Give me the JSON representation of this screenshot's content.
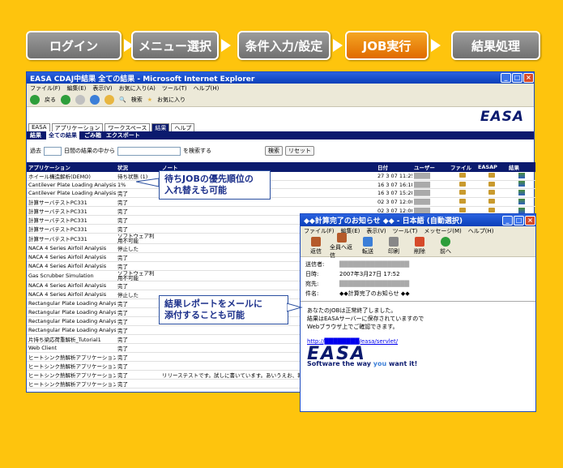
{
  "steps": [
    {
      "label": "ログイン",
      "active": false
    },
    {
      "label": "メニュー選択",
      "active": false
    },
    {
      "label": "条件入力/設定",
      "active": false
    },
    {
      "label": "JOB実行",
      "active": true
    },
    {
      "label": "結果処理",
      "active": false
    }
  ],
  "browser": {
    "title": "EASA CDAJ中結果 全ての結果 - Microsoft Internet Explorer",
    "menu": [
      "ファイル(F)",
      "編集(E)",
      "表示(V)",
      "お気に入り(A)",
      "ツール(T)",
      "ヘルプ(H)"
    ],
    "toolbar": {
      "back": "戻る",
      "search": "検索",
      "favorites": "お気に入り"
    },
    "logo": "EASA",
    "nav_tabs": [
      "EASA",
      "アプリケーション",
      "ワークスペース",
      "結果",
      "ヘルプ"
    ],
    "sub_tabs": [
      "結果",
      "全ての結果",
      "ごみ箱",
      "エクスポート"
    ],
    "filter": {
      "past_label": "過去",
      "days_label": "日間の結果の中から",
      "search_suffix": "を検索する",
      "search_button": "検索",
      "reset_button": "リセット"
    },
    "columns": {
      "app": "アプリケーション",
      "status": "状況",
      "note": "ノート",
      "date": "日付",
      "user": "ユーザー",
      "file": "ファイル",
      "easap": "EASAP",
      "result": "結果"
    },
    "rows": [
      {
        "app": "ホイール構造解析(DEMO)",
        "status": "待ち状態 (1)",
        "note": "",
        "date": "27 3 07 11:25",
        "user": "████"
      },
      {
        "app": "Cantilever Plate Loading Analysis",
        "status": "1%",
        "note": "",
        "date": "16 3 07 16:18",
        "user": "████"
      },
      {
        "app": "Cantilever Plate Loading Analysis",
        "status": "完了",
        "note": "",
        "date": "16 3 07 15:28",
        "user": "████"
      },
      {
        "app": "計算サーバテストPC331",
        "status": "完了",
        "note": "",
        "date": "02 3 07 12:00",
        "user": "████"
      },
      {
        "app": "計算サーバテストPC331",
        "status": "完了",
        "note": "",
        "date": "02 3 07 12:00",
        "user": "████"
      },
      {
        "app": "計算サーバテストPC331",
        "status": "完了",
        "note": "",
        "date": "",
        "user": ""
      },
      {
        "app": "計算サーバテストPC331",
        "status": "完了",
        "note": "",
        "date": "",
        "user": ""
      },
      {
        "app": "計算サーバテストPC331",
        "status": "ソフトウェア利用不可能",
        "note": "",
        "date": "",
        "user": ""
      },
      {
        "app": "NACA 4 Series Airfoil Analysis",
        "status": "停止した",
        "note": "",
        "date": "",
        "user": ""
      },
      {
        "app": "NACA 4 Series Airfoil Analysis",
        "status": "完了",
        "note": "",
        "date": "",
        "user": ""
      },
      {
        "app": "NACA 4 Series Airfoil Analysis",
        "status": "完了",
        "note": "",
        "date": "",
        "user": ""
      },
      {
        "app": "Gas Scrubber Simulation",
        "status": "ソフトウェア利用不可能",
        "note": "",
        "date": "",
        "user": ""
      },
      {
        "app": "NACA 4 Series Airfoil Analysis",
        "status": "完了",
        "note": "",
        "date": "",
        "user": ""
      },
      {
        "app": "NACA 4 Series Airfoil Analysis",
        "status": "停止した",
        "note": "",
        "date": "",
        "user": ""
      },
      {
        "app": "Rectangular Plate Loading Analysis",
        "status": "完了",
        "note": "",
        "date": "",
        "user": ""
      },
      {
        "app": "Rectangular Plate Loading Analysis",
        "status": "完了",
        "note": "",
        "date": "",
        "user": ""
      },
      {
        "app": "Rectangular Plate Loading Analysis",
        "status": "完了",
        "note": "",
        "date": "",
        "user": ""
      },
      {
        "app": "Rectangular Plate Loading Analysis",
        "status": "完了",
        "note": "",
        "date": "",
        "user": ""
      },
      {
        "app": "片持ち梁応荷重解析_Tutorial1",
        "status": "完了",
        "note": "",
        "date": "",
        "user": ""
      },
      {
        "app": "Web Client",
        "status": "完了",
        "note": "",
        "date": "",
        "user": ""
      },
      {
        "app": "ヒートシンク熱解析アプリケーション(DEMO)",
        "status": "完了",
        "note": "",
        "date": "",
        "user": ""
      },
      {
        "app": "ヒートシンク熱解析アプリケーション(DEMO)",
        "status": "完了",
        "note": "",
        "date": "",
        "user": ""
      },
      {
        "app": "ヒートシンク熱解析アプリケーション(DEMO)",
        "status": "完了",
        "note": "リリーステストです。試しに書いています。あいうえお、報告、車種、表示",
        "date": "",
        "user": ""
      },
      {
        "app": "ヒートシンク熱解析アプリケーション(DEMO)",
        "status": "完了",
        "note": "",
        "date": "",
        "user": ""
      }
    ]
  },
  "callouts": {
    "priority": "待ちJOBの優先順位の\n入れ替えも可能",
    "report": "結果レポートをメールに\n添付することも可能"
  },
  "mail": {
    "title": "◆◆計算完了のお知らせ ◆◆ - 日本語 (自動選択)",
    "menu": [
      "ファイル(F)",
      "編集(E)",
      "表示(V)",
      "ツール(T)",
      "メッセージ(M)",
      "ヘルプ(H)"
    ],
    "buttons": [
      "返信",
      "全員へ返信",
      "転送",
      "印刷",
      "削除",
      "前へ"
    ],
    "from_label": "送信者:",
    "from_value": "████████████████",
    "date_label": "日時:",
    "date_value": "2007年3月27日 17:52",
    "to_label": "宛先:",
    "to_value": "████████████████",
    "subject_label": "件名:",
    "subject_value": "◆◆計算完了のお知らせ ◆◆",
    "body": [
      "あなたのJOBは正常終了しました。",
      "結果はEASAサーバーに保存されていますので",
      "Webブラウザ上でご確認できます。"
    ],
    "link": "http://████████/easa/servlet/",
    "logo": "EASA",
    "tagline_a": "Software the way ",
    "tagline_b": "you",
    "tagline_c": " want it!"
  }
}
